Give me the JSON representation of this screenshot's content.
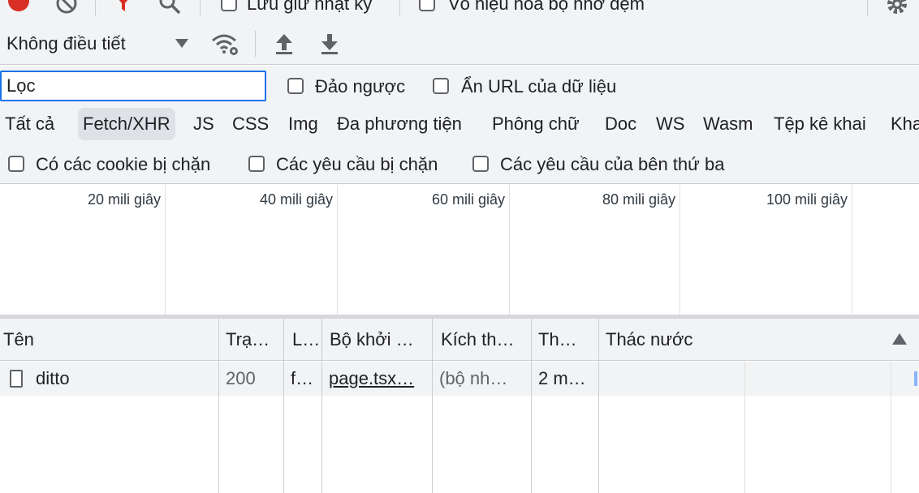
{
  "toolbar": {
    "preserve_log_label": "Lưu giữ nhật ký",
    "disable_cache_label": "Vô hiệu hoá bộ nhớ đệm"
  },
  "throttle": {
    "label": "Không điều tiết"
  },
  "filter": {
    "placeholder": "Lọc",
    "invert_label": "Đảo ngược",
    "hide_data_urls_label": "Ẩn URL của dữ liệu"
  },
  "type_tabs": [
    {
      "label": "Tất cả"
    },
    {
      "label": "Fetch/XHR"
    },
    {
      "label": "JS"
    },
    {
      "label": "CSS"
    },
    {
      "label": "Img"
    },
    {
      "label": "Đa phương tiện"
    },
    {
      "label": "Phông chữ"
    },
    {
      "label": "Doc"
    },
    {
      "label": "WS"
    },
    {
      "label": "Wasm"
    },
    {
      "label": "Tệp kê khai"
    },
    {
      "label": "Kha"
    }
  ],
  "active_tab": "Fetch/XHR",
  "blocked": {
    "cookies_label": "Có các cookie bị chặn",
    "requests_label": "Các yêu cầu bị chặn",
    "third_party_label": "Các yêu cầu của bên thứ ba"
  },
  "timeline": {
    "ticks": [
      "20 mili giây",
      "40 mili giây",
      "60 mili giây",
      "80 mili giây",
      "100 mili giây"
    ]
  },
  "table": {
    "headers": [
      "Tên",
      "Trạ…",
      "L…",
      "Bộ khởi …",
      "Kích th…",
      "Th…",
      "Thác nước"
    ],
    "rows": [
      {
        "name": "ditto",
        "status": "200",
        "type": "f…",
        "initiator": "page.tsx…",
        "size": "(bộ nh…",
        "time": "2 m…"
      }
    ]
  },
  "colors": {
    "record": "#d93025",
    "filter_funnel": "#d93025",
    "focus_border": "#1a73e8",
    "toolbar_bg": "#f1f3f4"
  }
}
